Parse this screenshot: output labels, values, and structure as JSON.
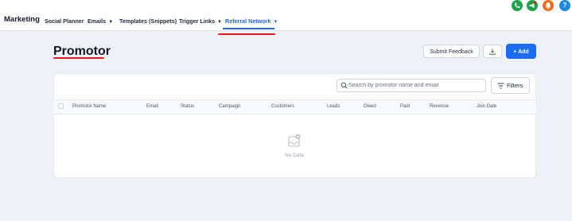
{
  "app": {
    "title": "Marketing"
  },
  "nav": {
    "items": [
      {
        "label": "Social Planner",
        "dropdown": false
      },
      {
        "label": "Emails",
        "dropdown": true
      },
      {
        "label": "Templates (Snippets)",
        "dropdown": false
      },
      {
        "label": "Trigger Links",
        "dropdown": true
      },
      {
        "label": "Referral Network",
        "dropdown": true,
        "active": true
      }
    ]
  },
  "top_icons": [
    {
      "name": "phone-icon",
      "glyph": "✆",
      "color": "#1aa34a"
    },
    {
      "name": "megaphone-icon",
      "glyph": "✎",
      "color": "#1aa34a"
    },
    {
      "name": "bell-icon",
      "glyph": "♪",
      "color": "#f26b1d"
    },
    {
      "name": "help-icon",
      "glyph": "?",
      "color": "#1e88e5"
    }
  ],
  "page": {
    "title": "Promotor",
    "submit_feedback_label": "Submit Feedback",
    "add_label": "+ Add"
  },
  "search": {
    "placeholder": "Search by promotor name and email"
  },
  "filters": {
    "label": "Filters"
  },
  "table": {
    "columns": [
      "Promotor Name",
      "Email",
      "Status",
      "Campaign",
      "Customers",
      "Leads",
      "Owed",
      "Paid",
      "Revenue",
      "Join Date"
    ],
    "rows": [],
    "empty_text": "No Data"
  },
  "colors": {
    "accent": "#1d6bf3",
    "annotation": "#e11d1d"
  }
}
